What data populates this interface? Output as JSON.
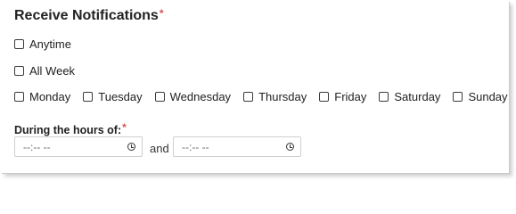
{
  "section": {
    "title": "Receive Notifications",
    "required_mark": "*"
  },
  "options": {
    "anytime": "Anytime",
    "all_week": "All Week",
    "days": [
      "Monday",
      "Tuesday",
      "Wednesday",
      "Thursday",
      "Friday",
      "Saturday",
      "Sunday"
    ]
  },
  "hours": {
    "label": "During the hours of:",
    "required_mark": "*",
    "start_placeholder": "--:-- --",
    "end_placeholder": "--:-- --",
    "separator": "and",
    "icon": "clock-icon"
  },
  "colors": {
    "required": "#d9534f",
    "border": "#cfcfcf"
  }
}
